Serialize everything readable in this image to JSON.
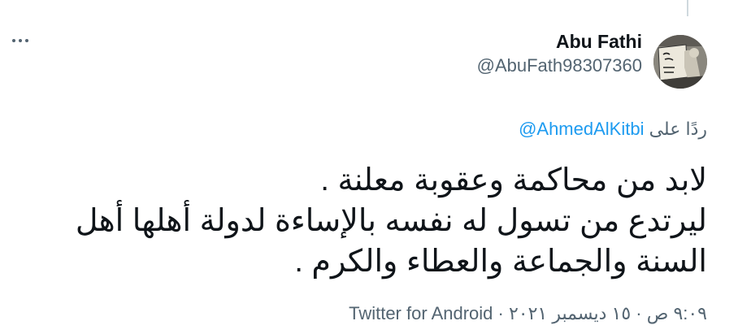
{
  "user": {
    "display_name": "Abu Fathi",
    "handle": "@AbuFath98307360",
    "avatar_icon": "profile-photo"
  },
  "more_icon": "more-horizontal-icon",
  "reply": {
    "prefix": "ردًا على",
    "mention": "@AhmedAlKitbi"
  },
  "tweet": {
    "lines": [
      "لابد من محاكمة وعقوبة معلنة .",
      "ليرتدع من تسول له نفسه بالإساءة لدولة أهلها أهل",
      "السنة والجماعة والعطاء والكرم ."
    ]
  },
  "meta": {
    "source": "Twitter for Android",
    "separator": " · ",
    "date": "١٥ ديسمبر ٢٠٢١",
    "time": "٩:٠٩ ص"
  },
  "colors": {
    "text": "#0f1419",
    "secondary": "#536471",
    "link": "#1d9bf0",
    "thread_line": "#cfd9de"
  }
}
